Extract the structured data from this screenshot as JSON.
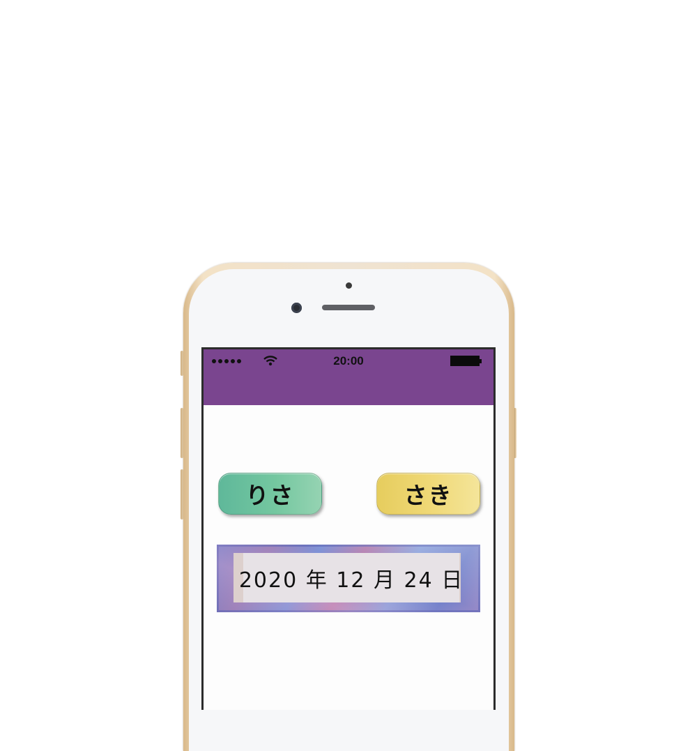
{
  "status_bar": {
    "time": "20:00",
    "signal_dots": 5,
    "wifi_icon": "wifi-icon",
    "battery_icon": "battery-icon",
    "color": "#7a458f"
  },
  "buttons": {
    "left_label": "りさ",
    "left_color": "#6fc3a0",
    "right_label": "さき",
    "right_color": "#eed56e"
  },
  "date_display": {
    "text": "2020 年 12 月 24 日"
  }
}
